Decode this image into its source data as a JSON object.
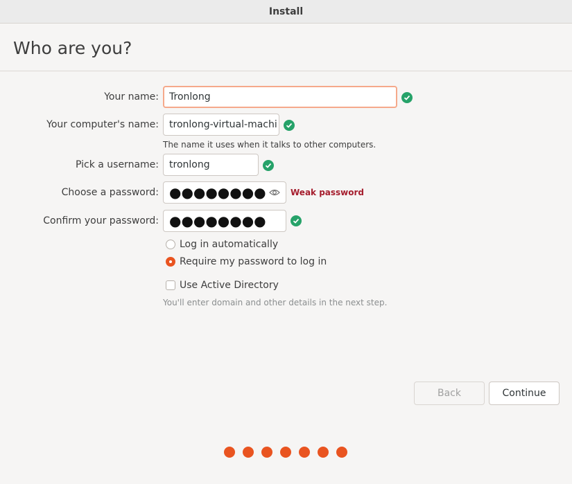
{
  "window": {
    "title": "Install"
  },
  "page": {
    "title": "Who are you?"
  },
  "form": {
    "name": {
      "label": "Your name:",
      "value": "Tronlong"
    },
    "computer_name": {
      "label": "Your computer's name:",
      "value": "tronlong-virtual-machi",
      "hint": "The name it uses when it talks to other computers."
    },
    "username": {
      "label": "Pick a username:",
      "value": "tronlong"
    },
    "password": {
      "label": "Choose a password:",
      "masked_value": "●●●●●●●●",
      "strength": "Weak password"
    },
    "confirm_password": {
      "label": "Confirm your password:",
      "masked_value": "●●●●●●●●"
    },
    "login_options": [
      {
        "label": "Log in automatically",
        "selected": false
      },
      {
        "label": "Require my password to log in",
        "selected": true
      }
    ],
    "active_directory": {
      "label": "Use Active Directory",
      "checked": false,
      "hint": "You'll enter domain and other details in the next step."
    }
  },
  "buttons": {
    "back": "Back",
    "continue": "Continue"
  },
  "progress": {
    "total_steps": 7
  },
  "colors": {
    "accent": "#e95420",
    "valid": "#26a269",
    "weak": "#a51d2d"
  },
  "icons": {
    "valid": "check-circle-icon",
    "reveal": "eye-icon"
  }
}
